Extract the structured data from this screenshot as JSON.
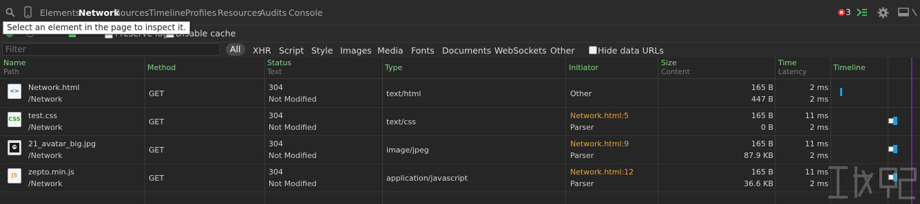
{
  "tabs": [
    "Elements",
    "Network",
    "Sources",
    "Timeline",
    "Profiles",
    "Resources",
    "Audits",
    "Console"
  ],
  "active_tab": "Network",
  "error_count": "3",
  "tooltip": "Select an element in the page to inspect it.",
  "toolbar2": {
    "preserve_log_label": "Preserve log",
    "disable_cache_label": "Disable cache"
  },
  "filter": {
    "placeholder": "Filter",
    "types": [
      "All",
      "XHR",
      "Script",
      "Style",
      "Images",
      "Media",
      "Fonts",
      "Documents",
      "WebSockets",
      "Other"
    ],
    "active_type": "All",
    "hide_data_urls_label": "Hide data URLs"
  },
  "columns": {
    "name": "Name",
    "path": "Path",
    "method": "Method",
    "status": "Status",
    "text": "Text",
    "type": "Type",
    "initiator": "Initiator",
    "size": "Size",
    "content": "Content",
    "time": "Time",
    "latency": "Latency",
    "timeline": "Timeline"
  },
  "rows": [
    {
      "icon": "html-file-icon",
      "icon_text": "<>",
      "name": "Network.html",
      "path": "/Network",
      "method": "GET",
      "status": "304",
      "status_text": "Not Modified",
      "type": "text/html",
      "initiator": "Other",
      "initiator_sub": "",
      "size": "165 B",
      "content": "447 B",
      "time": "2 ms",
      "latency": "2 ms"
    },
    {
      "icon": "css-file-icon",
      "icon_text": "CSS",
      "name": "test.css",
      "path": "/Network",
      "method": "GET",
      "status": "304",
      "status_text": "Not Modified",
      "type": "text/css",
      "initiator": "Network.html:5",
      "initiator_sub": "Parser",
      "size": "165 B",
      "content": "0 B",
      "time": "11 ms",
      "latency": "2 ms"
    },
    {
      "icon": "image-file-icon",
      "icon_text": "",
      "name": "21_avatar_big.jpg",
      "path": "/Network",
      "method": "GET",
      "status": "304",
      "status_text": "Not Modified",
      "type": "image/jpeg",
      "initiator": "Network.html:9",
      "initiator_sub": "Parser",
      "size": "165 B",
      "content": "87.9 KB",
      "time": "11 ms",
      "latency": "2 ms"
    },
    {
      "icon": "js-file-icon",
      "icon_text": "JS",
      "name": "zepto.min.js",
      "path": "/Network",
      "method": "GET",
      "status": "304",
      "status_text": "Not Modified",
      "type": "application/javascript",
      "initiator": "Network.html:12",
      "initiator_sub": "Parser",
      "size": "165 B",
      "content": "36.6 KB",
      "time": "11 ms",
      "latency": "2 ms"
    }
  ],
  "colors": {
    "accent_green": "#7fd87f",
    "link_orange": "#e0a341",
    "timeline_blue": "#1f9ee0",
    "error_red": "#e53935"
  }
}
